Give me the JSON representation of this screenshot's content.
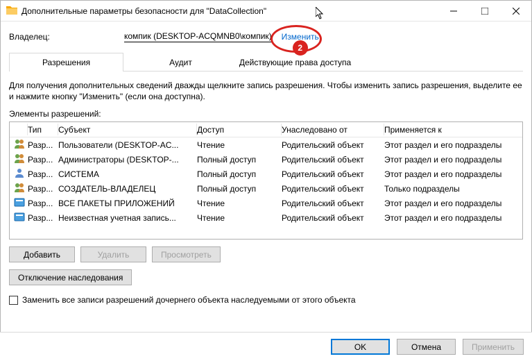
{
  "window": {
    "title": "Дополнительные параметры безопасности для \"DataCollection\""
  },
  "owner": {
    "label": "Владелец:",
    "value": "компик (DESKTOP-ACQMNB0\\компик)",
    "change": "Изменить",
    "badge": "2"
  },
  "tabs": {
    "perm": "Разрешения",
    "audit": "Аудит",
    "eff": "Действующие права доступа"
  },
  "instr": "Для получения дополнительных сведений дважды щелкните запись разрешения. Чтобы изменить запись разрешения, выделите ее и нажмите кнопку \"Изменить\" (если она доступна).",
  "sect_label": "Элементы разрешений:",
  "hdr": {
    "type": "Тип",
    "subj": "Субъект",
    "acc": "Доступ",
    "inh": "Унаследовано от",
    "app": "Применяется к"
  },
  "rows": [
    {
      "icon": "group",
      "type": "Разр...",
      "subj": "Пользователи (DESKTOP-AC...",
      "acc": "Чтение",
      "inh": "Родительский объект",
      "app": "Этот раздел и его подразделы"
    },
    {
      "icon": "group",
      "type": "Разр...",
      "subj": "Администраторы (DESKTOP-...",
      "acc": "Полный доступ",
      "inh": "Родительский объект",
      "app": "Этот раздел и его подразделы"
    },
    {
      "icon": "user",
      "type": "Разр...",
      "subj": "СИСТЕМА",
      "acc": "Полный доступ",
      "inh": "Родительский объект",
      "app": "Этот раздел и его подразделы"
    },
    {
      "icon": "group",
      "type": "Разр...",
      "subj": "СОЗДАТЕЛЬ-ВЛАДЕЛЕЦ",
      "acc": "Полный доступ",
      "inh": "Родительский объект",
      "app": "Только подразделы"
    },
    {
      "icon": "pkg",
      "type": "Разр...",
      "subj": "ВСЕ ПАКЕТЫ ПРИЛОЖЕНИЙ",
      "acc": "Чтение",
      "inh": "Родительский объект",
      "app": "Этот раздел и его подразделы"
    },
    {
      "icon": "pkg",
      "type": "Разр...",
      "subj": "Неизвестная учетная запись...",
      "acc": "Чтение",
      "inh": "Родительский объект",
      "app": "Этот раздел и его подразделы"
    }
  ],
  "buttons": {
    "add": "Добавить",
    "remove": "Удалить",
    "view": "Просмотреть",
    "disable_inh": "Отключение наследования",
    "replace_cb": "Заменить все записи разрешений дочернего объекта наследуемыми от этого объекта",
    "ok": "OK",
    "cancel": "Отмена",
    "apply": "Применить"
  }
}
